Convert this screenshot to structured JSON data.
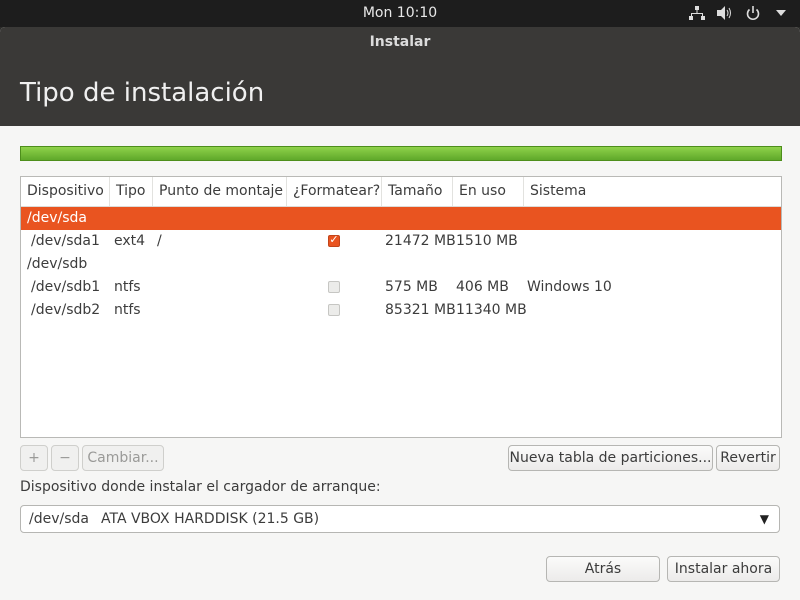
{
  "topbar": {
    "clock": "Mon 10:10",
    "icons": [
      "network-icon",
      "volume-icon",
      "power-icon",
      "menu-arrow-icon"
    ]
  },
  "window": {
    "title": "Instalar",
    "heading": "Tipo de instalación",
    "progress_percent": 100
  },
  "table": {
    "columns": [
      "Dispositivo",
      "Tipo",
      "Punto de montaje",
      "¿Formatear?",
      "Tamaño",
      "En uso",
      "Sistema"
    ],
    "rows": [
      {
        "device": "/dev/sda",
        "selected": true,
        "indent": false
      },
      {
        "device": "/dev/sda1",
        "type": "ext4",
        "mount": "/",
        "format": "checked",
        "size": "21472 MB",
        "used": "1510 MB",
        "system": ""
      },
      {
        "device": "/dev/sdb",
        "selected": false,
        "indent": false
      },
      {
        "device": "/dev/sdb1",
        "type": "ntfs",
        "mount": "",
        "format": "unchecked",
        "size": "575 MB",
        "used": "406 MB",
        "system": "Windows 10"
      },
      {
        "device": "/dev/sdb2",
        "type": "ntfs",
        "mount": "",
        "format": "unchecked",
        "size": "85321 MB",
        "used": "11340 MB",
        "system": ""
      }
    ]
  },
  "buttons": {
    "add": "+",
    "remove": "−",
    "change": "Cambiar...",
    "new_table": "Nueva tabla de particiones...",
    "revert": "Revertir",
    "back": "Atrás",
    "install_now": "Instalar ahora"
  },
  "bootloader": {
    "label": "Dispositivo donde instalar el cargador de arranque:",
    "device": "/dev/sda",
    "description": "ATA VBOX HARDDISK (21.5 GB)"
  },
  "colors": {
    "accent": "#e95420",
    "progress": "#76b836"
  }
}
